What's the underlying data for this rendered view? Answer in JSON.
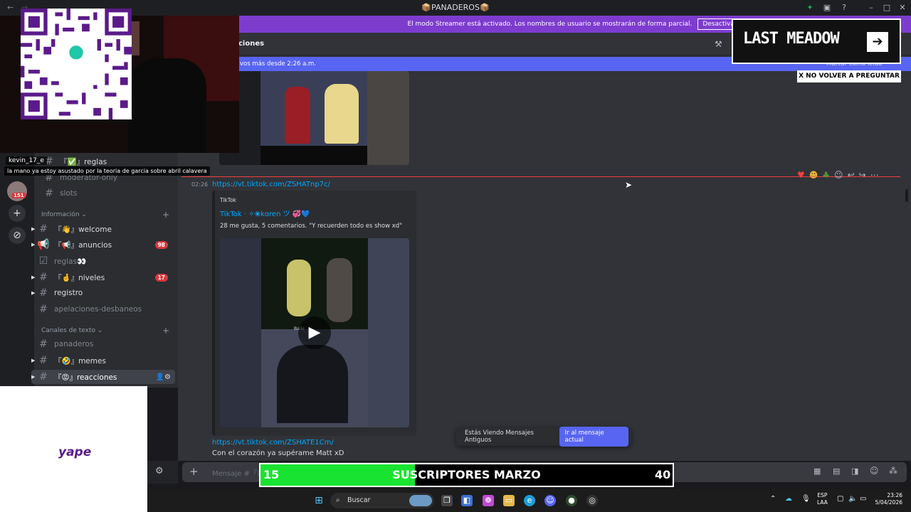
{
  "window": {
    "title": "📦PANADEROS📦"
  },
  "streamer_banner": {
    "message": "El modo Streamer está activado. Los nombres de usuario se mostrarán de forma parcial.",
    "button": "Desactivar"
  },
  "channel_header": {
    "name": "ciones"
  },
  "new_messages_bar": {
    "text": "vos más desde 2:26 a.m.",
    "mark_read": "Marcar como leído"
  },
  "server_rail": {
    "badge": "151"
  },
  "sidebar": {
    "top_items": [
      {
        "label": "『✅』reglas"
      },
      {
        "label": "moderator-only"
      },
      {
        "label": "slots"
      }
    ],
    "category_info": "Información",
    "info_items": [
      {
        "label": "『👋』welcome",
        "badge": ""
      },
      {
        "label": "『📢』anuncios",
        "badge": "98"
      },
      {
        "label": "reglas👀",
        "badge": ""
      },
      {
        "label": "『🤞』niveles",
        "badge": "17"
      },
      {
        "label": "registro",
        "badge": ""
      },
      {
        "label": "apelaciones-desbaneos",
        "badge": ""
      }
    ],
    "category_text": "Canales de texto",
    "text_items": [
      {
        "label": "panaderos"
      },
      {
        "label": "『🤣』memes"
      },
      {
        "label": "『😡』reacciones"
      }
    ]
  },
  "messages": {
    "time": "02:26",
    "link1": "https://vt.tiktok.com/ZSHATnp7c/",
    "embed_provider": "TikTok",
    "embed_author": "TikTok · ✧❀kɑren ツ 💞💙",
    "embed_desc": "28 me gusta, 5 comentarios. \"Y recuerden todo es show xd\"",
    "embed_video_caption": "Baile",
    "link2": "https://vt.tiktok.com/ZSHATE1Cm/",
    "text2": "Con  el corazón ya supérame Matt xD"
  },
  "toast": {
    "text": "Estás Viendo Mensajes Antiguos",
    "button": "Ir al mensaje actual"
  },
  "composer": {
    "placeholder": "Mensaje #『😡』"
  },
  "overlay": {
    "chat_user": "kevin_17_e",
    "chat_message": "la mano ya estoy asustado por la teoria de garcia sobre abril calavera",
    "qr_brand": "yape",
    "game_title": "LAST MEADOW",
    "dont_ask": "X NO VOLVER A PREGUNTAR",
    "sub_current": "15",
    "sub_title": "SUSCRIPTORES MARZO",
    "sub_goal": "40",
    "sub_progress": 0.375
  },
  "taskbar": {
    "search": "Buscar",
    "lang_1": "ESP",
    "lang_2": "LAA",
    "time": "23:26",
    "date": "5/04/2026"
  },
  "colors": {
    "streamer_purple": "#7e3ccf",
    "blurple": "#5865f2",
    "badge_red": "#da373c",
    "link_blue": "#00a8fc",
    "progress_green": "#19e331"
  }
}
